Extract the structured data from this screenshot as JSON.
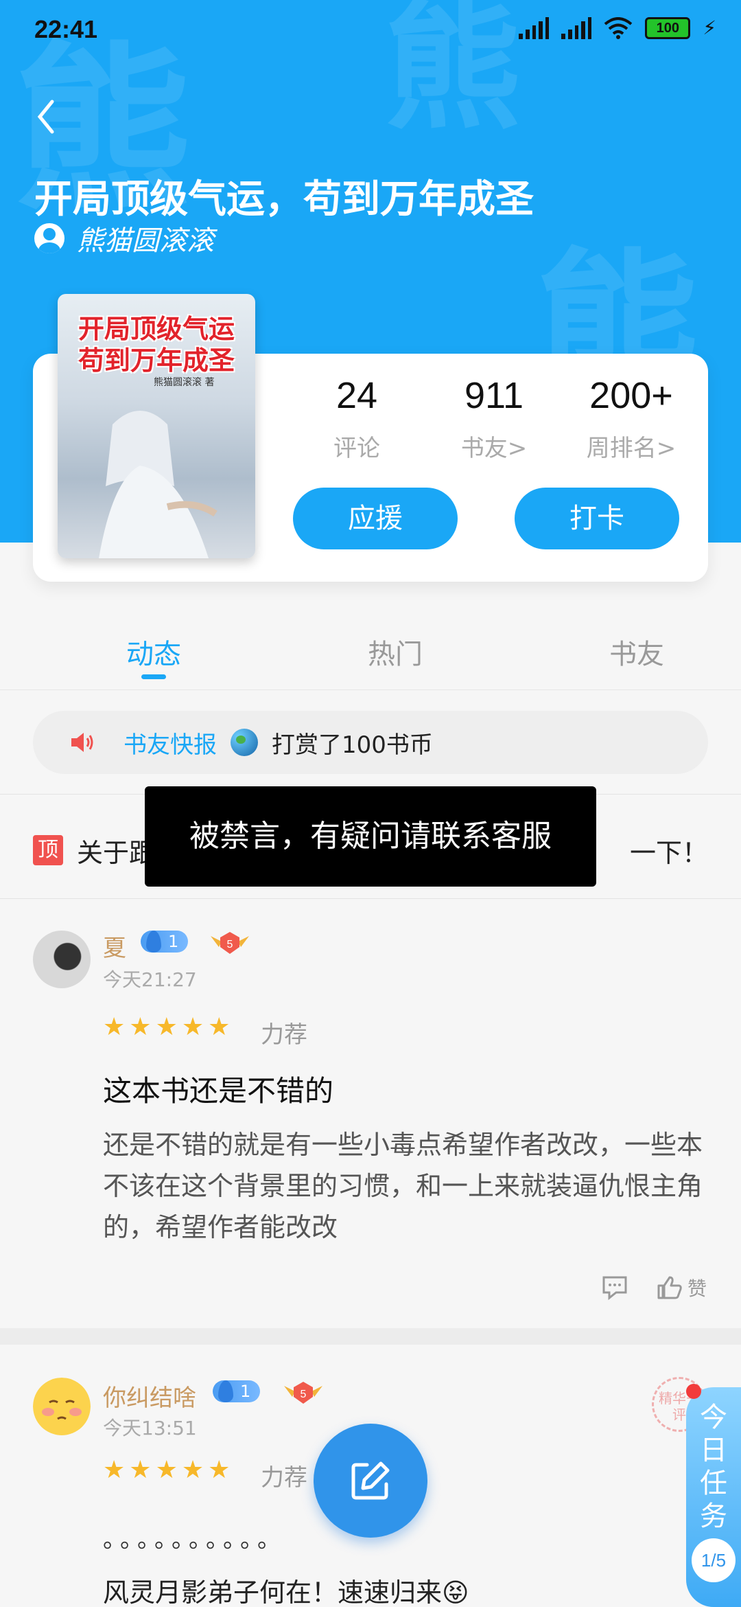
{
  "status_bar": {
    "time": "22:41",
    "battery": "100"
  },
  "header": {
    "title": "开局顶级气运，苟到万年成圣",
    "author": "熊猫圆滚滚",
    "watermark": [
      "熊",
      "熊",
      "熊"
    ]
  },
  "cover": {
    "line1": "开局顶级气运",
    "line2": "苟到万年成圣",
    "author_small": "熊猫圆滚滚 著"
  },
  "stats": [
    {
      "value": "24",
      "label": "评论"
    },
    {
      "value": "911",
      "label": "书友>"
    },
    {
      "value": "200+",
      "label": "周排名>"
    }
  ],
  "buttons": {
    "support": "应援",
    "checkin": "打卡"
  },
  "tabs": [
    {
      "label": "动态",
      "active": true
    },
    {
      "label": "热门",
      "active": false
    },
    {
      "label": "书友",
      "active": false
    }
  ],
  "news": {
    "label": "书友快报",
    "text": "打赏了100书币"
  },
  "pinned": {
    "badge": "顶",
    "text_start": "关于",
    "text_mid": "跟",
    "text_end": "一下！"
  },
  "toast": "被禁言，有疑问请联系客服",
  "posts": [
    {
      "user": "夏",
      "level": "1",
      "medal": "5",
      "time": "今天21:27",
      "rating_text": "力荐",
      "title": "这本书还是不错的",
      "body": "还是不错的就是有一些小毒点希望作者改改，一些本不该在这个背景里的习惯，和一上来就装逼仇恨主角的，希望作者能改改",
      "like_label": "赞"
    },
    {
      "user": "你纠结啥",
      "level": "1",
      "medal": "5",
      "time": "今天13:51",
      "rating_text": "力荐",
      "dots": "。。。。。。。。。。",
      "line": "风灵月影弟子何在！速速归来😝"
    }
  ],
  "task_widget": {
    "text": "今日任务",
    "progress": "1/5",
    "stamp": "精华书评"
  },
  "colors": {
    "brand": "#1aa7f6",
    "star": "#f7b82a",
    "username": "#c99a62"
  }
}
